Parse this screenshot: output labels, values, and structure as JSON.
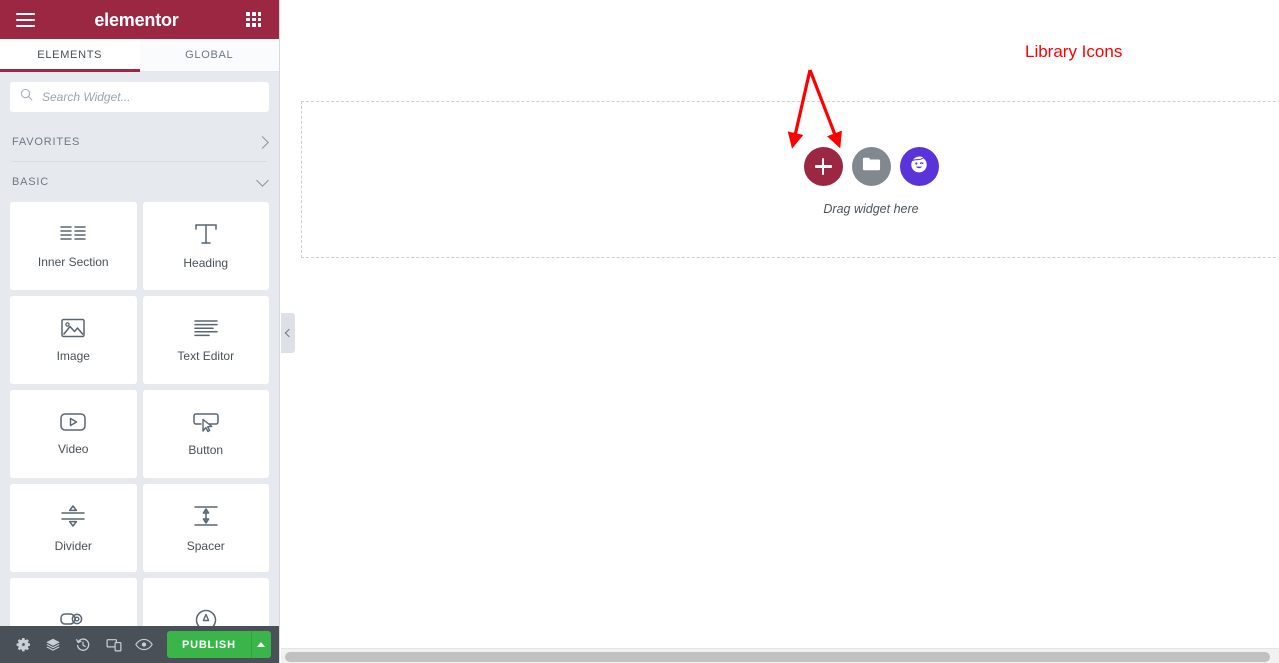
{
  "app": {
    "name": "Elementor",
    "logo_text": "elementor"
  },
  "panel": {
    "header": {
      "menu_icon": "hamburger-menu-icon",
      "apps_icon": "apps-grid-icon"
    },
    "tabs": [
      {
        "label": "ELEMENTS",
        "active": true
      },
      {
        "label": "GLOBAL",
        "active": false
      }
    ],
    "search": {
      "placeholder": "Search Widget...",
      "value": "",
      "icon": "search-icon"
    },
    "categories": [
      {
        "label": "FAVORITES",
        "expanded": false,
        "chevron": "chevron-right-icon"
      },
      {
        "label": "BASIC",
        "expanded": true,
        "chevron": "chevron-down-icon"
      }
    ],
    "widgets": [
      {
        "label": "Inner Section",
        "icon": "inner-section-icon"
      },
      {
        "label": "Heading",
        "icon": "heading-icon"
      },
      {
        "label": "Image",
        "icon": "image-icon"
      },
      {
        "label": "Text Editor",
        "icon": "text-editor-icon"
      },
      {
        "label": "Video",
        "icon": "video-icon"
      },
      {
        "label": "Button",
        "icon": "button-icon"
      },
      {
        "label": "Divider",
        "icon": "divider-icon"
      },
      {
        "label": "Spacer",
        "icon": "spacer-icon"
      },
      {
        "label": "",
        "icon": "google-maps-icon"
      },
      {
        "label": "",
        "icon": "icon-widget-icon"
      }
    ],
    "footer": {
      "buttons": [
        {
          "name": "settings",
          "icon": "gear-icon"
        },
        {
          "name": "navigator",
          "icon": "layers-icon"
        },
        {
          "name": "history",
          "icon": "history-icon"
        },
        {
          "name": "responsive-mode",
          "icon": "responsive-icon"
        },
        {
          "name": "preview-changes",
          "icon": "eye-icon"
        }
      ],
      "publish_label": "PUBLISH",
      "publish_color": "#39b54a",
      "publish_options_icon": "caret-up-icon"
    }
  },
  "canvas": {
    "collapse_handle_icon": "chevron-left-icon",
    "section": {
      "drag_hint": "Drag widget here",
      "buttons": [
        {
          "name": "add-new-section",
          "icon": "plus-icon",
          "color": "#9b2743"
        },
        {
          "name": "add-template-library",
          "icon": "folder-icon",
          "color": "#82888f"
        },
        {
          "name": "ai-library",
          "icon": "smiley-face-icon",
          "color": "#5a34d8"
        }
      ]
    }
  },
  "annotation": {
    "label": "Library Icons",
    "color": "#ff0000",
    "arrow_targets": [
      "add-template-library",
      "ai-library"
    ]
  },
  "scrollbar": {
    "orientation": "horizontal",
    "name": "canvas-horizontal-scrollbar"
  },
  "colors": {
    "brand": "#9b2743",
    "panel_bg": "#e6eaee",
    "footer_bg": "#495058",
    "publish": "#39b54a",
    "accent_purple": "#5a34d8",
    "annotation_red": "#ff0000"
  }
}
